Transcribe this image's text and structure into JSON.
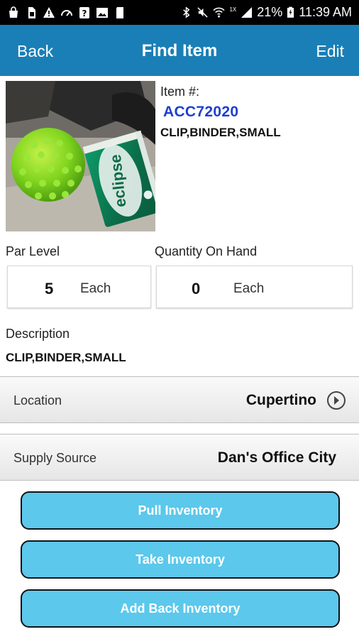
{
  "status_bar": {
    "battery_percent": "21%",
    "time": "11:39 AM",
    "network_label": "1X"
  },
  "nav": {
    "back_label": "Back",
    "title": "Find Item",
    "edit_label": "Edit"
  },
  "item": {
    "number_label": "Item #:",
    "number": "ACC72020",
    "name": "CLIP,BINDER,SMALL"
  },
  "par_level": {
    "label": "Par Level",
    "value": "5",
    "unit": "Each"
  },
  "quantity_on_hand": {
    "label": "Quantity On Hand",
    "value": "0",
    "unit": "Each"
  },
  "description": {
    "label": "Description",
    "text": "CLIP,BINDER,SMALL"
  },
  "location": {
    "label": "Location",
    "value": "Cupertino"
  },
  "supply_source": {
    "label": "Supply Source",
    "value": "Dan's Office City"
  },
  "actions": {
    "pull": "Pull Inventory",
    "take": "Take Inventory",
    "add_back": "Add Back Inventory"
  },
  "photo": {
    "brand_text": "eclipse"
  },
  "colors": {
    "nav_bar": "#1a7fb6",
    "item_number": "#1e3fd0",
    "action_button": "#5bc8ec"
  }
}
